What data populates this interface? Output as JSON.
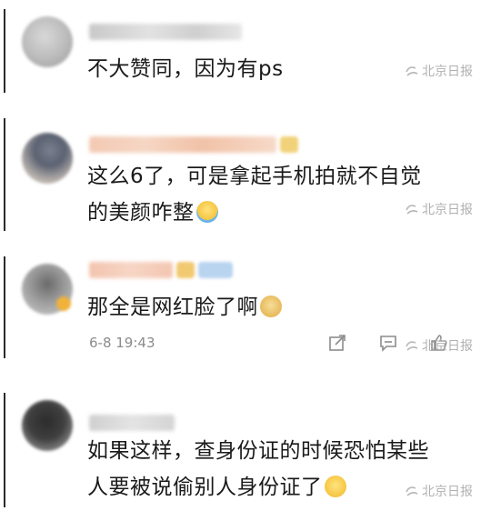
{
  "colors": {
    "text": "#1a1a1a",
    "watermark": "#b0b0b0",
    "meta": "#8c8c8c",
    "background": "#ffffff"
  },
  "watermark": "北京日报",
  "comments": [
    {
      "text_lines": [
        "不大赞同，因为有ps"
      ],
      "emoji": null
    },
    {
      "text_lines": [
        "这么6了，可是拿起手机拍就不自觉",
        "的美颜咋整"
      ],
      "emoji": "shrug-emoji"
    },
    {
      "text_lines": [
        "那全是网红脸了啊"
      ],
      "emoji": "doge-emoji",
      "timestamp": "6-8 19:43"
    },
    {
      "text_lines": [
        "如果这样，查身份证的时候恐怕某些",
        "人要被说偷别人身份证了"
      ],
      "emoji": "thinking-emoji"
    }
  ]
}
